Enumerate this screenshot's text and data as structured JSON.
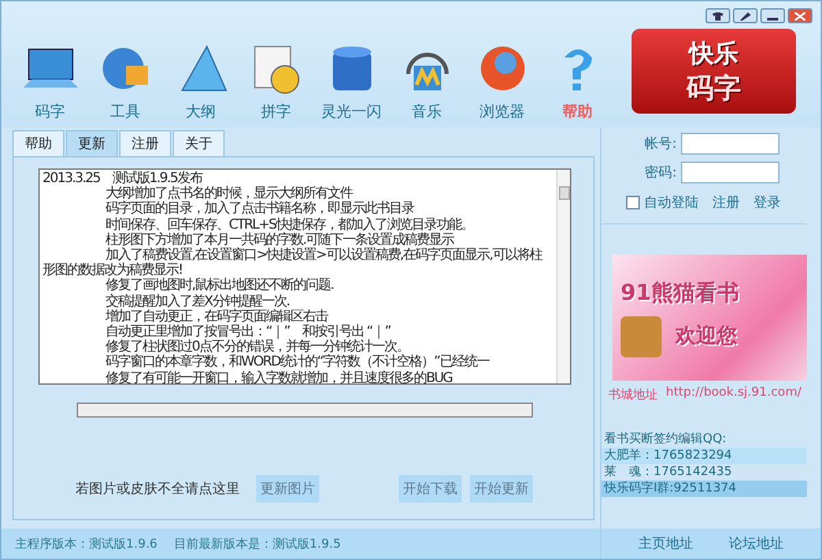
{
  "toolbar": [
    {
      "label": "码字",
      "selected": false
    },
    {
      "label": "工具",
      "selected": false
    },
    {
      "label": "大纲",
      "selected": false
    },
    {
      "label": "拼字",
      "selected": false
    },
    {
      "label": "灵光一闪",
      "selected": false
    },
    {
      "label": "音乐",
      "selected": false
    },
    {
      "label": "浏览器",
      "selected": false
    },
    {
      "label": "帮助",
      "selected": true
    }
  ],
  "logo": {
    "line_1": "快乐",
    "line_2": "码字"
  },
  "tabs": [
    {
      "label": "帮助",
      "selected": false
    },
    {
      "label": "更新",
      "selected": true
    },
    {
      "label": "注册",
      "selected": false
    },
    {
      "label": "关于",
      "selected": false
    }
  ],
  "changelog": [
    {
      "text": "2013.3.25　测试版1.9.5发布",
      "kind": "heading"
    },
    {
      "text": "大纲增加了点书名的时候，显示大纲所有文件",
      "kind": "item"
    },
    {
      "text": "码字页面的目录，加入了点击书籍名称，即显示此书目录",
      "kind": "item"
    },
    {
      "text": "时间保存、回车保存、CTRL+S快捷保存，都加入了浏览目录功能。",
      "kind": "item"
    },
    {
      "text": "柱形图下方增加了本月一共码的字数.可随下一条设置成稿费显示",
      "kind": "item"
    },
    {
      "text": "加入了稿费设置,在设置窗口>快捷设置>可以设置稿费,在码字页面显示,可以将柱形图的数据改为稿费显示!",
      "kind": "item"
    },
    {
      "text": "修复了画地图时,鼠标出地图还不断的问题.",
      "kind": "item"
    },
    {
      "text": "交稿提醒加入了差X分钟提醒一次.",
      "kind": "item"
    },
    {
      "text": "增加了自动更正，在码字页面编辑区右击",
      "kind": "item"
    },
    {
      "text": "自动更正里增加了按冒号出：“｜”　和按引号出 “｜”",
      "kind": "item"
    },
    {
      "text": "修复了柱状图过0点不分的错误，并每一分钟统计一次。",
      "kind": "item"
    },
    {
      "text": "码字窗口的本章字数，和WORD统计的“字符数（不计空格）”已经统一",
      "kind": "item"
    },
    {
      "text": "修复了有可能一开窗口，输入字数就增加，并且速度很多的BUG",
      "kind": "item"
    }
  ],
  "progress": {
    "level": 0
  },
  "hint": "若图片或皮肤不全请点这里",
  "buttons": [
    {
      "label": "更新图片",
      "disabled": true
    },
    {
      "label": "开始下载",
      "disabled": true
    },
    {
      "label": "开始更新",
      "disabled": true
    }
  ],
  "status": {
    "current": "主程序版本：测试版1.9.6",
    "latest": "目前最新版本是：测试版1.9.5"
  },
  "login": {
    "account_label": "帐号:",
    "password_label": "密码:",
    "auto_login": {
      "label": "自动登陆",
      "checked": false
    },
    "register": "注册",
    "login": "登录"
  },
  "banner": {
    "title": "91熊猫看书",
    "subtitle": "欢迎您"
  },
  "store": {
    "label": "书城地址",
    "url": "http://book.sj.91.com/"
  },
  "contacts": [
    "看书买断签约编辑QQ:",
    "大肥羊：1765823294",
    "莱　魂：1765142435",
    "快乐码字I群:92511374"
  ],
  "footer_links": [
    "主页地址",
    "论坛地址"
  ]
}
